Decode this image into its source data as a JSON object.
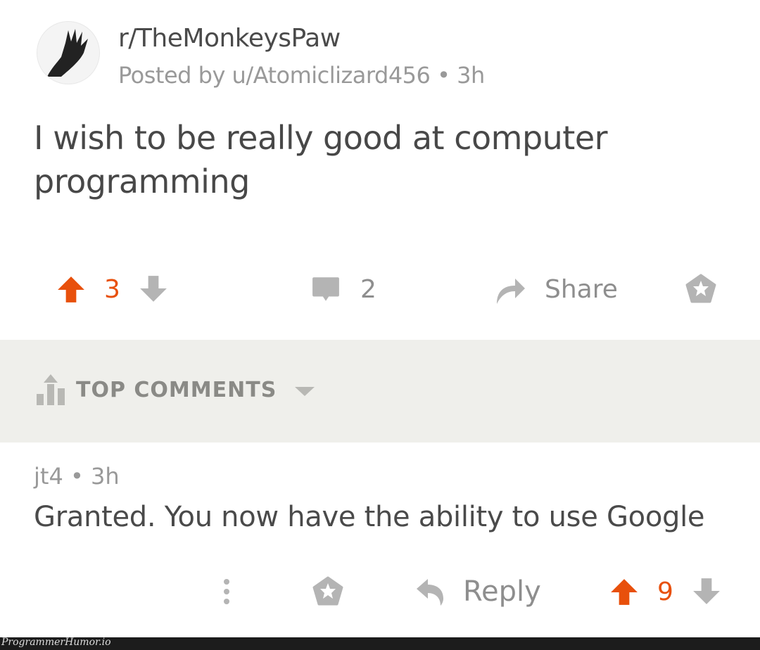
{
  "post": {
    "subreddit": "r/TheMonkeysPaw",
    "posted_by": "Posted by u/Atomiclizard456",
    "separator": "•",
    "age": "3h",
    "title": "I wish to be really good at computer programming",
    "score": "3",
    "comments": "2",
    "share_label": "Share"
  },
  "comments_section": {
    "sort_label": "TOP COMMENTS"
  },
  "comment": {
    "author": "jt4",
    "separator": "•",
    "age": "3h",
    "body": "Granted. You now have the ability to use Google",
    "reply_label": "Reply",
    "score": "9"
  },
  "watermark": "ProgrammerHumor.io",
  "colors": {
    "upvote": "#e8500c",
    "icon_grey": "#b4b4b4",
    "section_bg": "#efefeb"
  }
}
